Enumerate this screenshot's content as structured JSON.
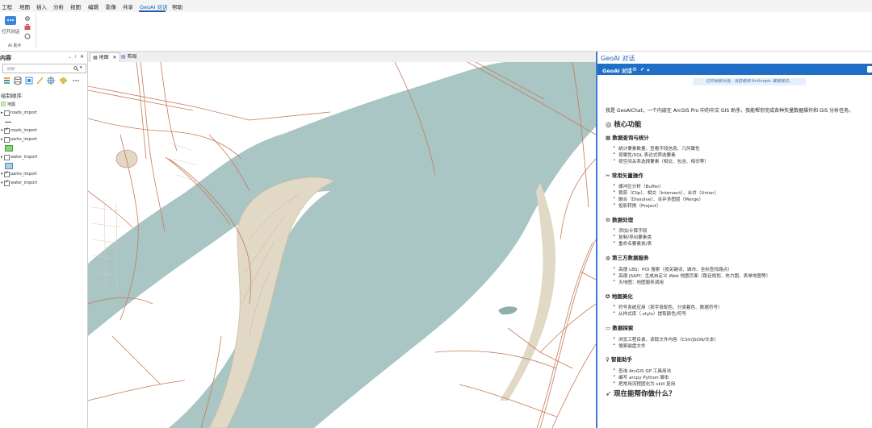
{
  "menu": {
    "items": [
      "工程",
      "地图",
      "插入",
      "分析",
      "视图",
      "编辑",
      "影像",
      "共享",
      "GeoAI 对话",
      "帮助"
    ],
    "active_index": 8
  },
  "ribbon": {
    "open_chat_label": "打开对话",
    "group_label": "AI 助手"
  },
  "contents": {
    "title": "内容",
    "search_placeholder": "搜索",
    "drawing_order": "绘制顺序",
    "map_name": "地图",
    "layers": [
      {
        "name": "roads_import",
        "checked": false
      },
      {
        "name": "roads_import",
        "checked": true
      },
      {
        "name": "parks_import",
        "checked": false
      },
      {
        "name": "water_import",
        "checked": false
      },
      {
        "name": "parks_import",
        "checked": true
      },
      {
        "name": "water_import",
        "checked": true
      }
    ],
    "swatch_colors": {
      "parks": "#7fd87a",
      "water": "#a9cfe8"
    }
  },
  "map_tabs": [
    "地图",
    "布局"
  ],
  "map_colors": {
    "water": "#a9c6c4",
    "land": "#ffffff",
    "park": "#e2d8c6",
    "road": "#c87a5a"
  },
  "geoai": {
    "pane_title": "GeoAI 对话",
    "bar_title": "GeoAI 对话",
    "notice": "已开始新对话，当前使用 Anthropic 兼容模式。",
    "intro": "我是 GeoAIChat，一个内嵌在 ArcGIS Pro 中的中文 GIS 助手。我能帮你完成各种矢量数据操作和 GIS 分析任务。",
    "core_title": "核心功能",
    "sections": [
      {
        "icon": "table-icon",
        "title": "数据查询与统计",
        "bullets": [
          "统计要素数量、查看字段信息、几何属性",
          "按属性/SQL 表达式筛选要素",
          "按空间关系选择要素（相交、包含、相邻等）"
        ]
      },
      {
        "icon": "scissors-icon",
        "title": "常用矢量操作",
        "bullets": [
          "缓冲区分析（Buffer）",
          "裁剪（Clip）、相交（Intersect）、合并（Union）",
          "融合（Dissolve）、合并多图层（Merge）",
          "投影转换（Project）"
        ]
      },
      {
        "icon": "gear-icon",
        "title": "数据处理",
        "bullets": [
          "添加/计算字段",
          "复制/导出要素类",
          "重命名要素类/表"
        ]
      },
      {
        "icon": "globe-icon",
        "title": "第三方数据服务",
        "bullets": [
          "高德 LBS：POI 搜索（按关键词、城市、坐标查找路点）",
          "高德 JSAPI：生成自定义 Web 地图页面（路径规划、热力图、表单地图等）",
          "天地图：地图服务调用"
        ]
      },
      {
        "icon": "palette-icon",
        "title": "地图美化",
        "bullets": [
          "符号系统应用（按字段配色、分类着色、数据符号）",
          "从样式库（.stylx）提取颜色/符号"
        ]
      },
      {
        "icon": "folder-icon",
        "title": "数据探索",
        "bullets": [
          "浏览工程目录、读取文件内容（CSV/JSON/文本）",
          "搜索磁盘文件"
        ]
      },
      {
        "icon": "lightbulb-icon",
        "title": "智能助手",
        "bullets": [
          "查询 ArcGIS GP 工具用法",
          "编写 arcpy Python 脚本",
          "把常用流程固化为 skill 复用"
        ]
      }
    ],
    "closing": "现在能帮你做什么？"
  }
}
